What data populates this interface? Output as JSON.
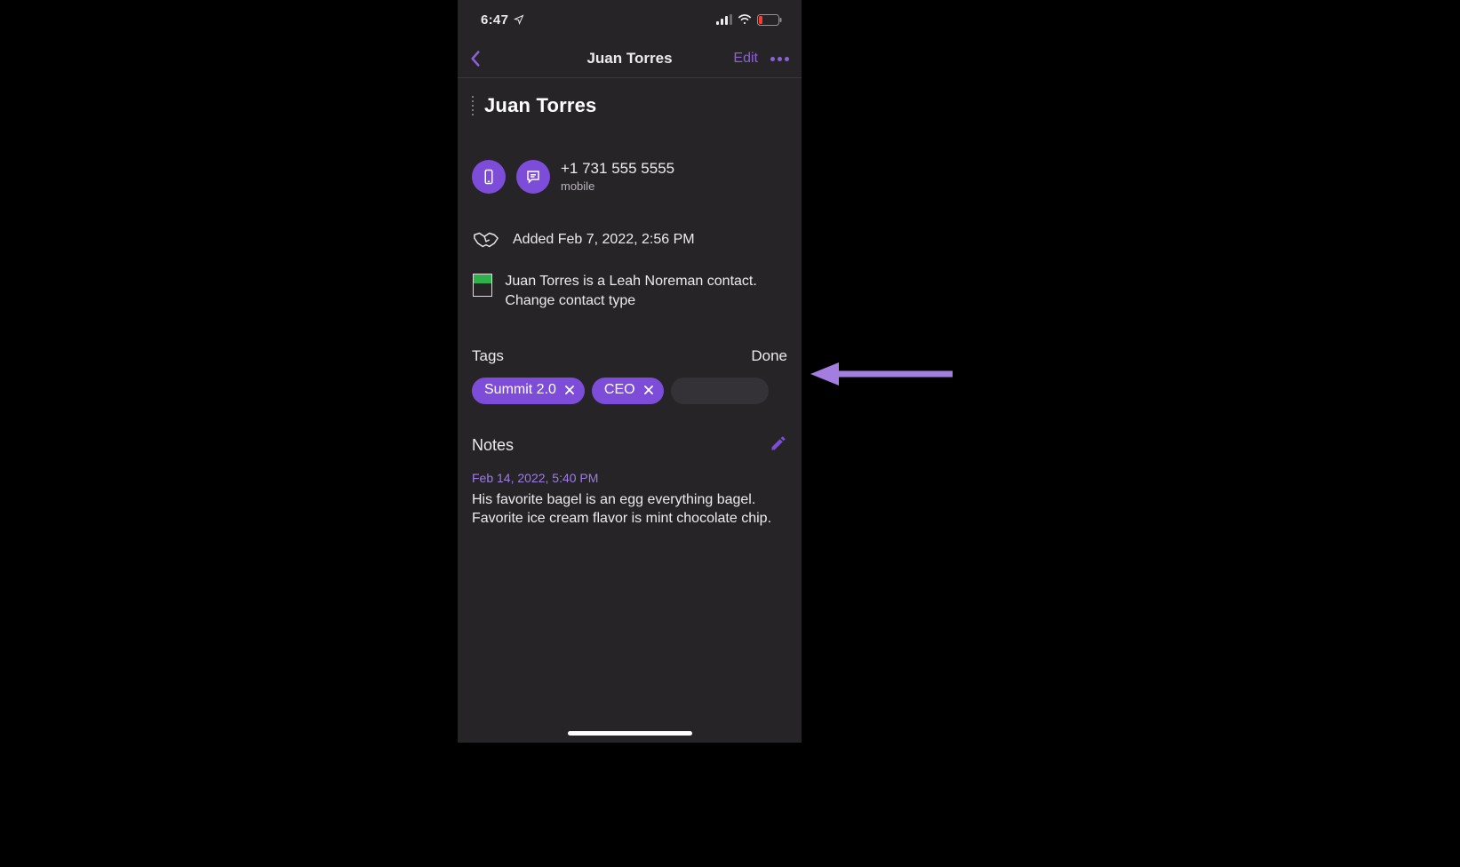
{
  "status": {
    "time": "6:47"
  },
  "navbar": {
    "title": "Juan Torres",
    "edit_label": "Edit"
  },
  "contact": {
    "name": "Juan Torres",
    "phone": "+1 731 555 5555",
    "phone_type": "mobile",
    "added_text": "Added Feb 7, 2022, 2:56 PM",
    "contact_type_text": "Juan Torres is a Leah Noreman contact. Change contact type"
  },
  "tags": {
    "label": "Tags",
    "done_label": "Done",
    "items": [
      {
        "label": "Summit 2.0"
      },
      {
        "label": "CEO"
      }
    ]
  },
  "notes": {
    "label": "Notes",
    "date": "Feb 14, 2022, 5:40 PM",
    "body": "His favorite bagel is an egg everything bagel. Favorite ice cream flavor is mint chocolate chip."
  }
}
